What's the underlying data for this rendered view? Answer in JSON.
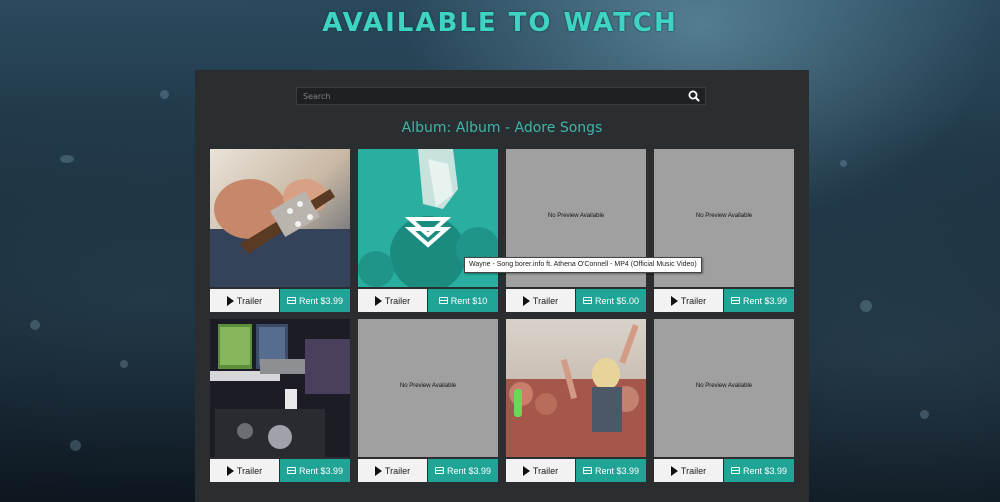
{
  "header": {
    "title": "AVAILABLE TO WATCH"
  },
  "search": {
    "placeholder": "Search",
    "value": ""
  },
  "album": {
    "title": "Album: Album - Adore Songs"
  },
  "tooltip": {
    "text": "Wayne - Song borer.info ft. Athena O'Connell - MP4 (Official Music Video)"
  },
  "colors": {
    "accent": "#1fa496",
    "title": "#3fd3c4",
    "panel": "#2b2e31"
  },
  "cards": [
    {
      "thumb": "guitar-photo",
      "preview": "",
      "trailer_label": "Trailer",
      "rent_label": "Rent $3.99"
    },
    {
      "thumb": "teal-vinyl-photo",
      "preview": "",
      "trailer_label": "Trailer",
      "rent_label": "Rent $10"
    },
    {
      "thumb": "none",
      "preview": "No Preview Available",
      "trailer_label": "Trailer",
      "rent_label": "Rent $5.00"
    },
    {
      "thumb": "none",
      "preview": "No Preview Available",
      "trailer_label": "Trailer",
      "rent_label": "Rent $3.99"
    },
    {
      "thumb": "dj-booth-photo",
      "preview": "",
      "trailer_label": "Trailer",
      "rent_label": "Rent $3.99"
    },
    {
      "thumb": "none",
      "preview": "No Preview Available",
      "trailer_label": "Trailer",
      "rent_label": "Rent $3.99"
    },
    {
      "thumb": "crowd-photo",
      "preview": "",
      "trailer_label": "Trailer",
      "rent_label": "Rent $3.99"
    },
    {
      "thumb": "none",
      "preview": "No Preview Available",
      "trailer_label": "Trailer",
      "rent_label": "Rent $3.99"
    }
  ]
}
